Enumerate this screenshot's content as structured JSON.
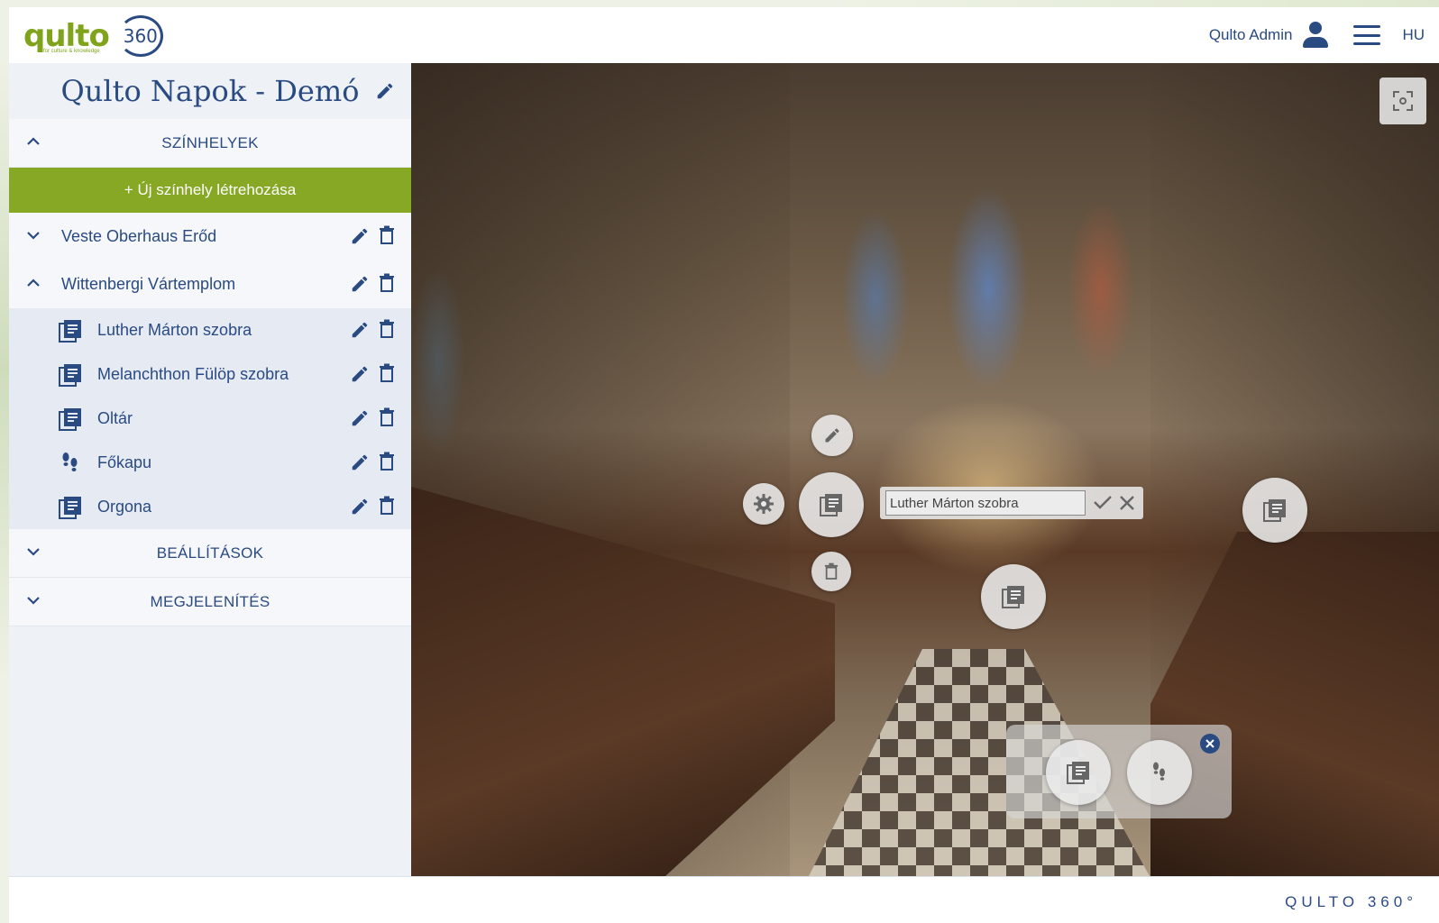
{
  "header": {
    "logo_text_1": "qu",
    "logo_text_2": "lto",
    "logo_tagline": "for culture & knowledge",
    "logo_360": "360",
    "user_name": "Qulto Admin",
    "language": "HU"
  },
  "sidebar": {
    "project_title": "Qulto Napok - Demó",
    "scenes_heading": "SZÍNHELYEK",
    "new_scene_label": "+ Új színhely létrehozása",
    "places": [
      {
        "label": "Veste Oberhaus Erőd"
      },
      {
        "label": "Wittenbergi Vártemplom"
      }
    ],
    "items": [
      {
        "label": "Luther Márton szobra",
        "icon": "document-icon"
      },
      {
        "label": "Melanchthon Fülöp szobra",
        "icon": "document-icon"
      },
      {
        "label": "Oltár",
        "icon": "document-icon"
      },
      {
        "label": "Főkapu",
        "icon": "footsteps-icon"
      },
      {
        "label": "Orgona",
        "icon": "document-icon"
      }
    ],
    "settings_heading": "BEÁLLÍTÁSOK",
    "display_heading": "MEGJELENÍTÉS"
  },
  "viewer": {
    "hotspot_name_value": "Luther Márton szobra"
  },
  "footer": {
    "brand": "QULTO 360°"
  },
  "colors": {
    "primary": "#2a4a82",
    "accent": "#86a825"
  }
}
